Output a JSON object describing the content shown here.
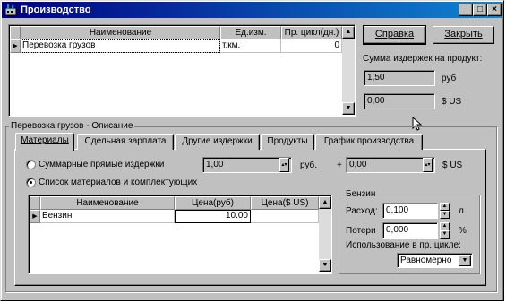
{
  "window": {
    "title": "Производство",
    "controls": {
      "minimize": "_",
      "maximize": "□",
      "close": "×"
    }
  },
  "products_table": {
    "columns": [
      "Наименование",
      "Ед.изм.",
      "Пр. цикл(дн.)"
    ],
    "rows": [
      {
        "name": "Перевозка грузов",
        "unit": "т.км.",
        "cycle": "0"
      }
    ]
  },
  "buttons": {
    "help": "Справка",
    "close": "Закрыть"
  },
  "cost_summary": {
    "label": "Сумма издержек на продукт:",
    "rub_value": "1,50",
    "rub_unit": "руб",
    "usd_value": "0,00",
    "usd_unit": "$ US"
  },
  "description_group": {
    "title": "Перевозка грузов - Описание"
  },
  "tabs": [
    {
      "label": "Материалы",
      "active": true
    },
    {
      "label": "Сдельная зарплата",
      "active": false
    },
    {
      "label": "Другие издержки",
      "active": false
    },
    {
      "label": "Продукты",
      "active": false
    },
    {
      "label": "График производства",
      "active": false
    }
  ],
  "materials": {
    "radio_total": {
      "label": "Суммарные прямые издержки",
      "selected": false
    },
    "total_rub": "1,00",
    "total_rub_unit": "руб.",
    "plus": "+",
    "total_usd": "0,00",
    "total_usd_unit": "$ US",
    "radio_list": {
      "label": "Список материалов и комплектующих",
      "selected": true
    },
    "columns": [
      "Наименование",
      "Цена(руб)",
      "Цена($ US)"
    ],
    "rows": [
      {
        "name": "Бензин",
        "price_rub": "10.00",
        "price_usd": ""
      }
    ]
  },
  "fuel_group": {
    "title": "Бензин",
    "consumption_label": "Расход:",
    "consumption_value": "0,100",
    "consumption_unit": "л.",
    "losses_label": "Потери",
    "losses_value": "0,000",
    "losses_unit": "%",
    "usage_label": "Использование в пр. цикле:",
    "usage_value": "Равномерно"
  }
}
